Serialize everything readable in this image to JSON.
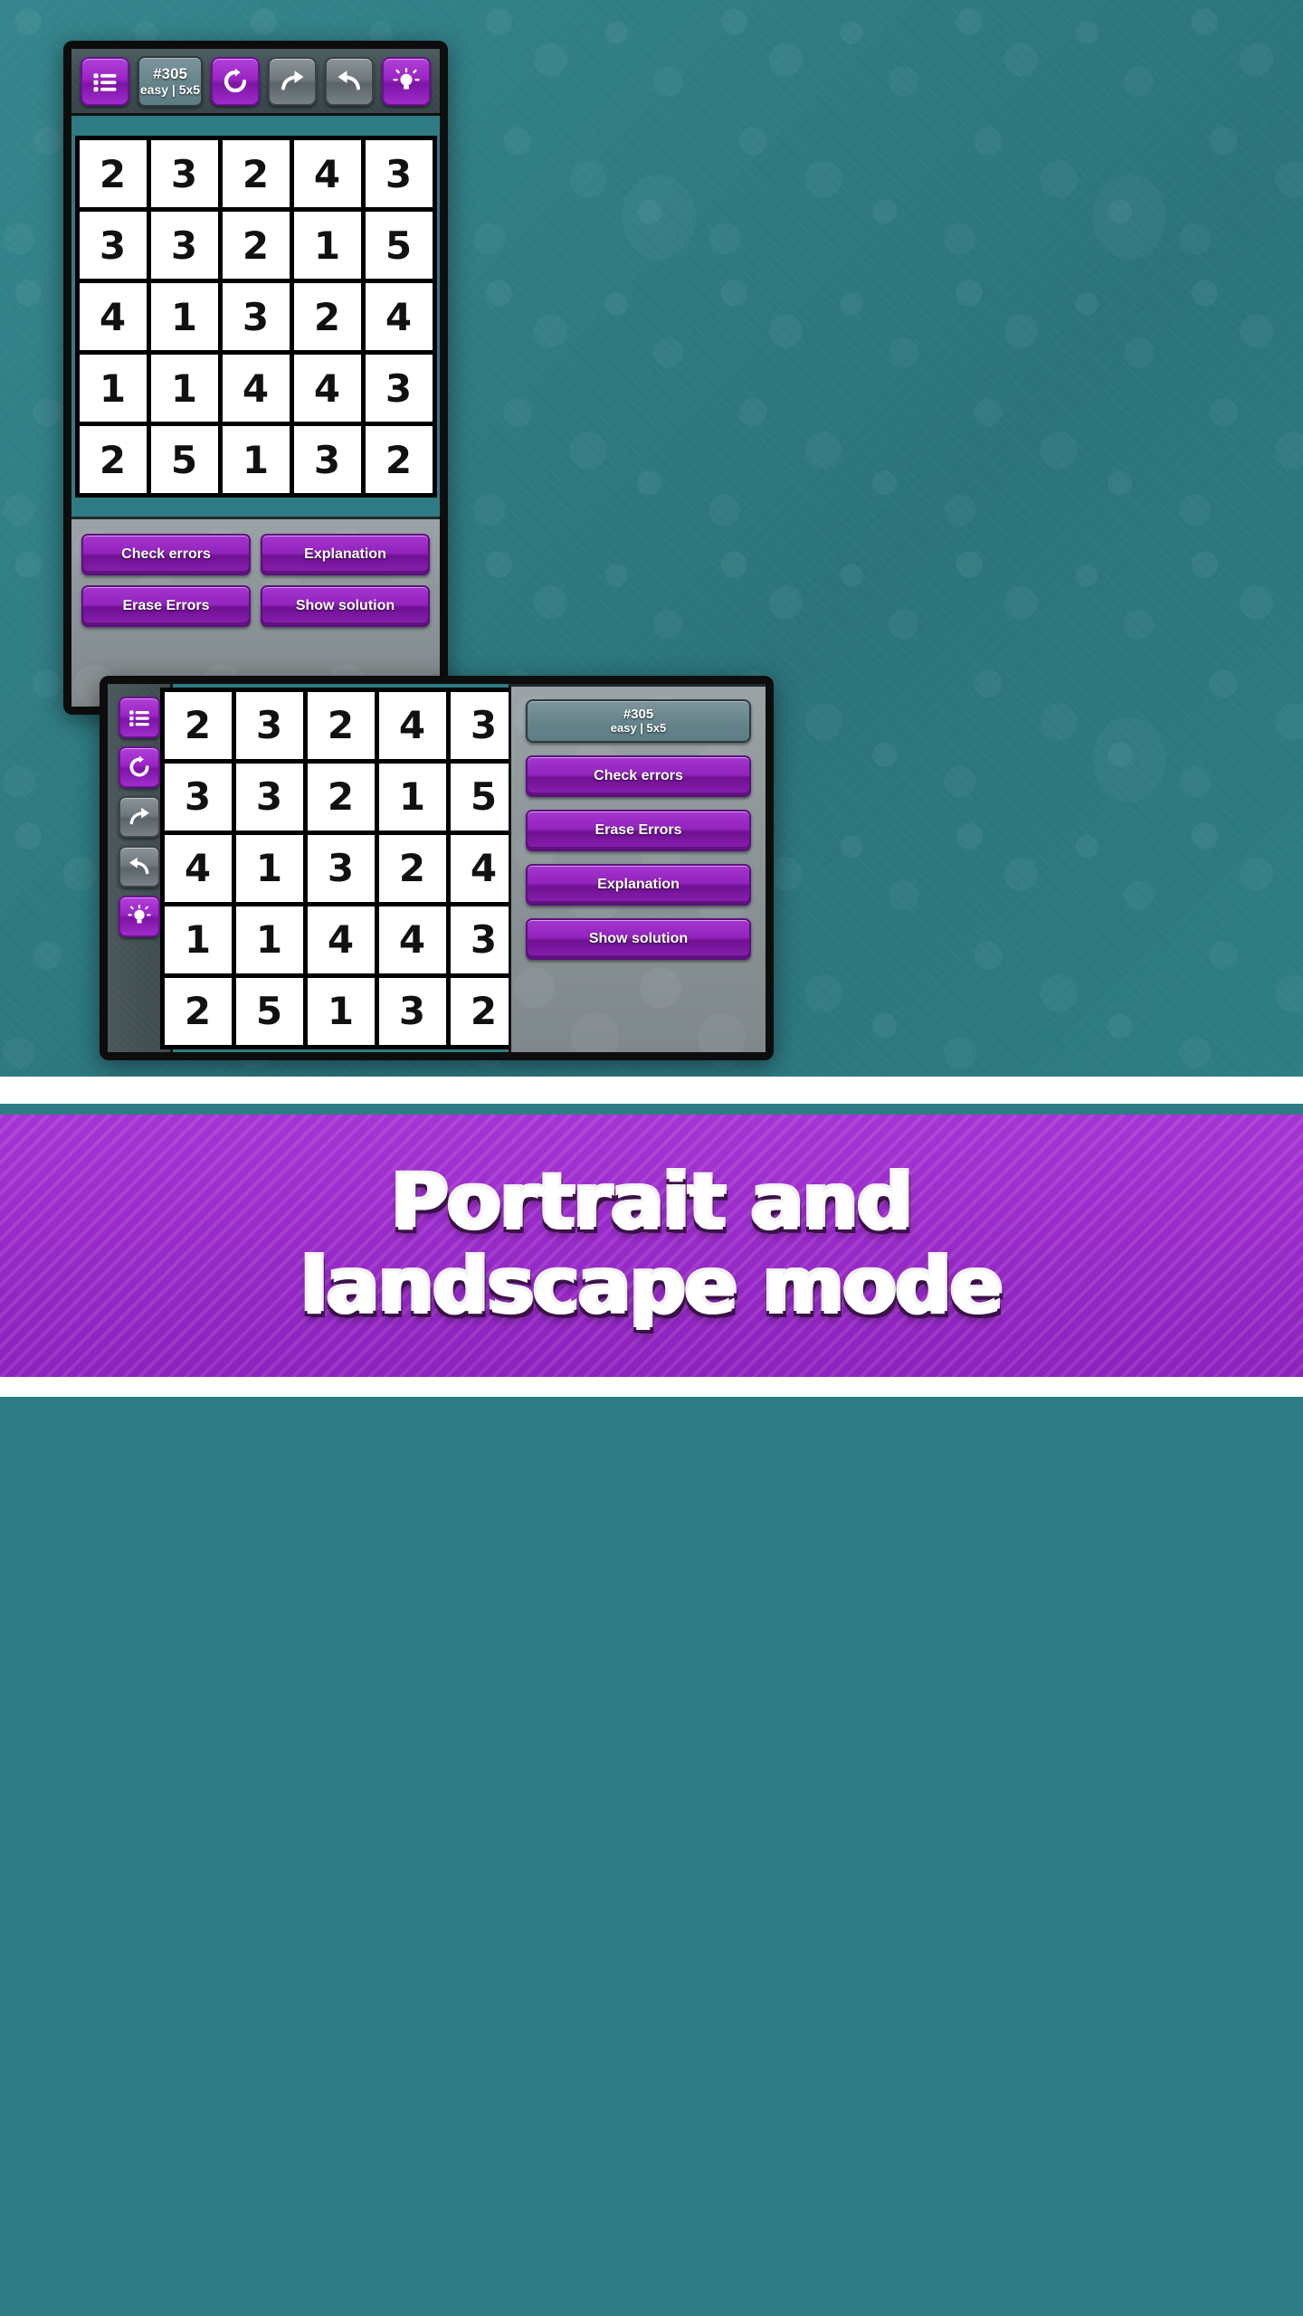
{
  "banner": {
    "line1": "Portrait and",
    "line2": "landscape mode",
    "accent_color": "#9a2bca"
  },
  "puzzle": {
    "id": "#305",
    "meta": "easy | 5x5",
    "size": "5x5",
    "difficulty": "easy",
    "grid": [
      [
        "2",
        "3",
        "2",
        "4",
        "3"
      ],
      [
        "3",
        "3",
        "2",
        "1",
        "5"
      ],
      [
        "4",
        "1",
        "3",
        "2",
        "4"
      ],
      [
        "1",
        "1",
        "4",
        "4",
        "3"
      ],
      [
        "2",
        "5",
        "1",
        "3",
        "2"
      ]
    ]
  },
  "portrait": {
    "toolbar": {
      "menu_icon": "list-icon",
      "info_id": "#305",
      "info_meta": "easy | 5x5",
      "refresh_icon": "refresh-icon",
      "redo_icon": "redo-arrow-icon",
      "undo_icon": "undo-arrow-icon",
      "hint_icon": "lightbulb-icon"
    },
    "actions": [
      {
        "label": "Check errors",
        "name": "check-errors-button"
      },
      {
        "label": "Explanation",
        "name": "explanation-button"
      },
      {
        "label": "Erase Errors",
        "name": "erase-errors-button"
      },
      {
        "label": "Show solution",
        "name": "show-solution-button"
      }
    ]
  },
  "landscape": {
    "sidebar_icons": [
      "list-icon",
      "refresh-icon",
      "redo-arrow-icon",
      "undo-arrow-icon",
      "lightbulb-icon"
    ],
    "info_id": "#305",
    "info_meta": "easy | 5x5",
    "actions": [
      {
        "label": "Check errors",
        "name": "check-errors-button"
      },
      {
        "label": "Erase Errors",
        "name": "erase-errors-button"
      },
      {
        "label": "Explanation",
        "name": "explanation-button"
      },
      {
        "label": "Show solution",
        "name": "show-solution-button"
      }
    ]
  },
  "colors": {
    "background": "#2f7b83",
    "purple": "#9a2bca",
    "panel_gray": "#8d9699",
    "toolbar_gray": "#3e4c50"
  }
}
